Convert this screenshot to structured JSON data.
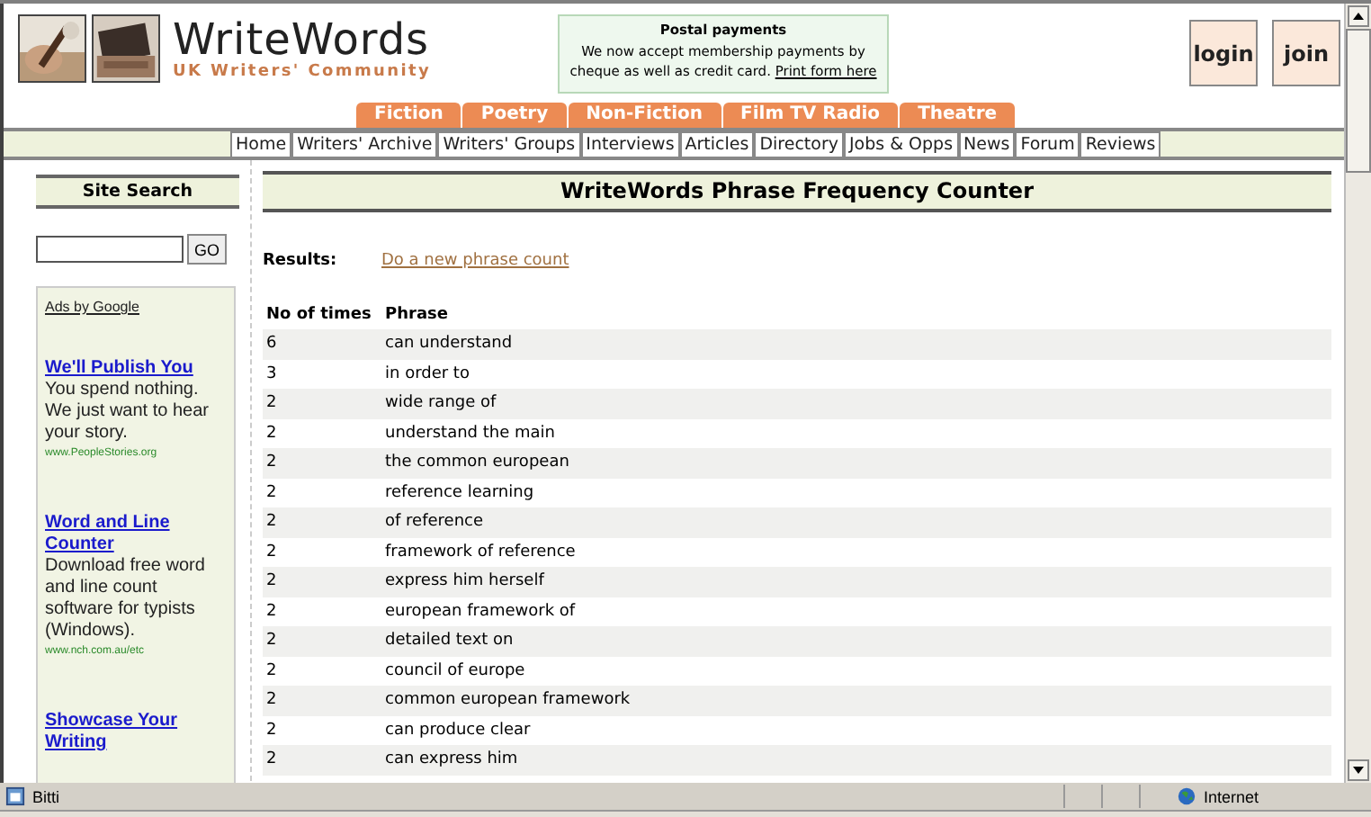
{
  "header": {
    "logo_title": "WriteWords",
    "logo_subtitle": "UK Writers' Community",
    "notice": {
      "title": "Postal payments",
      "text": "We now accept membership payments by cheque as well as credit card.",
      "link": "Print form here"
    },
    "buttons": [
      "login",
      "join"
    ]
  },
  "categories": [
    "Fiction",
    "Poetry",
    "Non-Fiction",
    "Film TV Radio",
    "Theatre"
  ],
  "nav": [
    "Home",
    "Writers' Archive",
    "Writers' Groups",
    "Interviews",
    "Articles",
    "Directory",
    "Jobs & Opps",
    "News",
    "Forum",
    "Reviews"
  ],
  "sidebar": {
    "search_title": "Site Search",
    "search_button": "GO",
    "ads_label": "Ads by Google",
    "ads": [
      {
        "title": "We'll Publish You",
        "text": "You spend nothing. We just want to hear your story.",
        "url": "www.PeopleStories.org"
      },
      {
        "title": "Word and Line Counter",
        "text": "Download free word and line count software for typists (Windows).",
        "url": "www.nch.com.au/etc"
      },
      {
        "title": "Showcase Your Writing"
      }
    ]
  },
  "main": {
    "title": "WriteWords Phrase Frequency Counter",
    "results_label": "Results:",
    "new_count_link": "Do a new phrase count",
    "table": {
      "columns": [
        "No of times",
        "Phrase"
      ],
      "rows": [
        [
          "6",
          "can understand"
        ],
        [
          "3",
          "in order to"
        ],
        [
          "2",
          "wide range of"
        ],
        [
          "2",
          "understand the main"
        ],
        [
          "2",
          "the common european"
        ],
        [
          "2",
          "reference learning"
        ],
        [
          "2",
          "of reference"
        ],
        [
          "2",
          "framework of reference"
        ],
        [
          "2",
          "express him herself"
        ],
        [
          "2",
          "european framework of"
        ],
        [
          "2",
          "detailed text on"
        ],
        [
          "2",
          "council of europe"
        ],
        [
          "2",
          "common european framework"
        ],
        [
          "2",
          "can produce clear"
        ],
        [
          "2",
          "can express him"
        ]
      ]
    }
  },
  "status_bar": {
    "text": "Bitti",
    "zone": "Internet"
  }
}
